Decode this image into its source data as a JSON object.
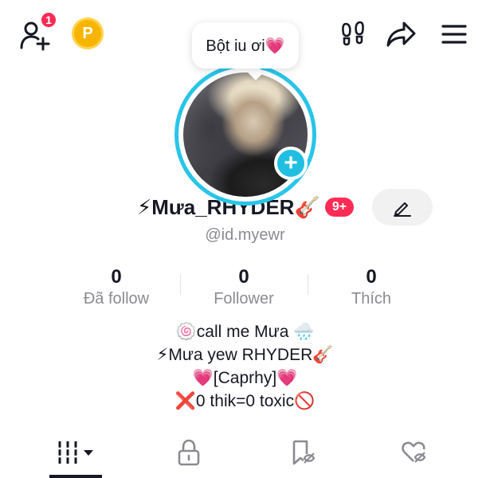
{
  "header": {
    "notification_count": "1",
    "coin_label": "P",
    "note_text": "Bột iu ơi💗"
  },
  "profile": {
    "display_name": "⚡Mưa_RHYDER🎸",
    "message_badge": "9+",
    "handle": "@id.myewr"
  },
  "stats": [
    {
      "value": "0",
      "label": "Đã follow"
    },
    {
      "value": "0",
      "label": "Follower"
    },
    {
      "value": "0",
      "label": "Thích"
    }
  ],
  "bio": [
    "🍥call me Mưa 🌧️",
    "⚡Mưa yew RHYDER🎸",
    "💗[Caprhy]💗",
    "❌0 thik=0 toxic🚫"
  ],
  "tabs": {
    "active": "videos",
    "icons": [
      "grid-icon",
      "lock-icon",
      "repost-icon",
      "liked-icon"
    ]
  },
  "colors": {
    "accent_red": "#fe2c55",
    "ring_cyan": "#29c5e8",
    "coin_gold": "#f7b500"
  }
}
